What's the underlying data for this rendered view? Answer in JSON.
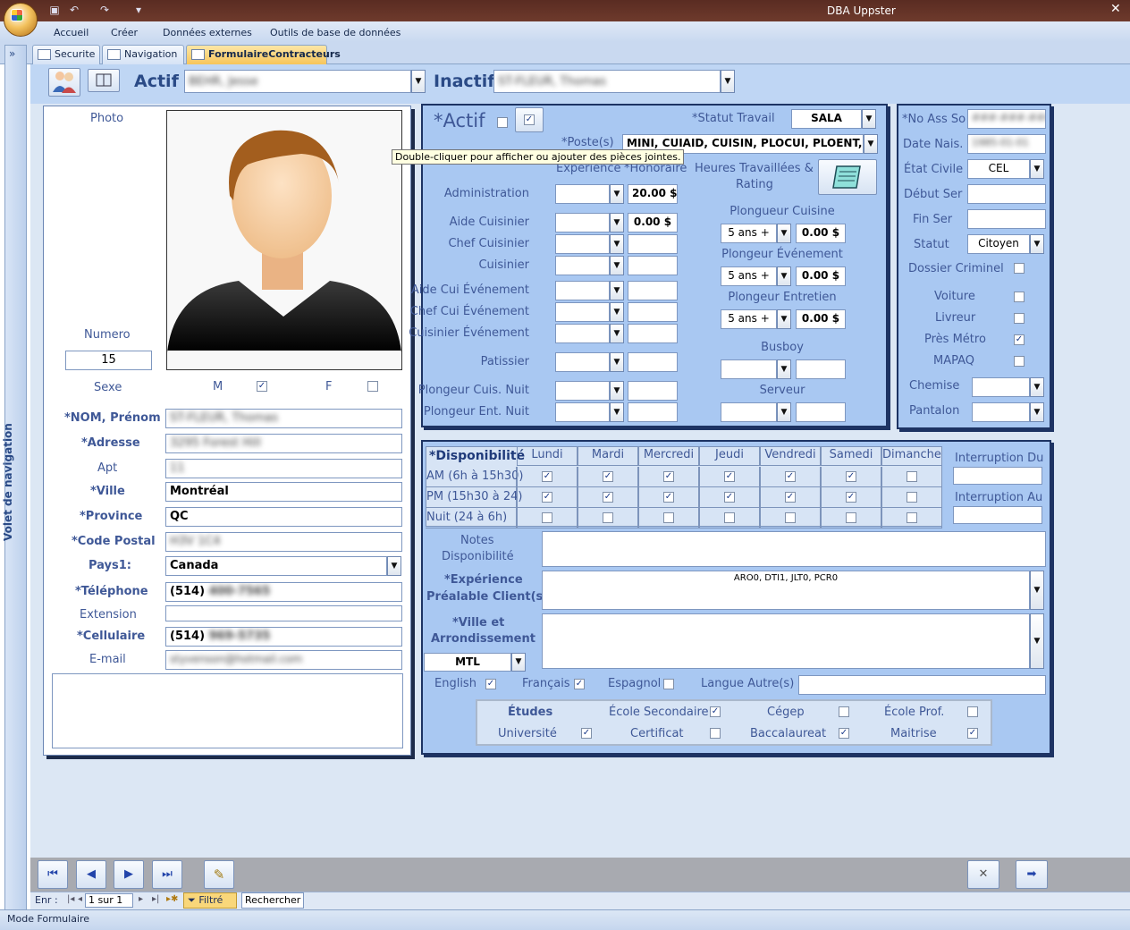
{
  "window": {
    "title": "DBA Uppster",
    "mode": "Mode Formulaire"
  },
  "ribbon": {
    "tabs": [
      "Accueil",
      "Créer",
      "Données externes",
      "Outils de base de données"
    ]
  },
  "nav_pane": {
    "label": "Volet de navigation",
    "toggle": "»"
  },
  "doc_tabs": [
    "Securite",
    "Navigation",
    "FormulaireContracteurs"
  ],
  "header": {
    "actif_label": "Actif",
    "actif_value": "BEHR, Jesse",
    "inactif_label": "Inactif",
    "inactif_value": "ST-FLEUR, Thomas"
  },
  "left": {
    "photo_label": "Photo",
    "numero_label": "Numero",
    "numero_value": "15",
    "sexe_label": "Sexe",
    "m_label": "M",
    "f_label": "F",
    "m_checked": true,
    "f_checked": false,
    "nom_label": "*NOM, Prénom",
    "nom_value": "ST-FLEUR, Thomas",
    "adresse_label": "*Adresse",
    "adresse_value": "3295 Forest Hill",
    "apt_label": "Apt",
    "apt_value": "11",
    "ville_label": "*Ville",
    "ville_value": "Montréal",
    "province_label": "*Province",
    "province_value": "QC",
    "cp_label": "*Code Postal",
    "cp_value": "H3V 1C4",
    "pays_label": "Pays1:",
    "pays_value": "Canada",
    "tel_label": "*Téléphone",
    "tel_prefix": "(514)",
    "tel_rest": "400-7565",
    "ext_label": "Extension",
    "cell_label": "*Cellulaire",
    "cell_prefix": "(514)",
    "cell_rest": "969-5735",
    "email_label": "E-mail",
    "email_value": "styvenson@hotmail.com"
  },
  "middle": {
    "actif_label": "*Actif",
    "statut_label": "*Statut Travail",
    "statut_value": "SALA",
    "poste_label": "*Poste(s)",
    "poste_value": "MINI, CUIAID, CUISIN, PLOCUI, PLOENT, PLOEVE",
    "tooltip": "Double-cliquer pour afficher ou ajouter des pièces jointes.",
    "exp_label": "Expérience",
    "hon_label": "*Honoraire",
    "heures_label1": "Heures Travaillées &",
    "heures_label2": "Rating",
    "roles": [
      {
        "label": "Administration",
        "exp": "",
        "hon": "20.00 $"
      },
      {
        "label": "Aide Cuisinier",
        "exp": "",
        "hon": "0.00 $"
      },
      {
        "label": "Chef Cuisinier",
        "exp": "",
        "hon": ""
      },
      {
        "label": "Cuisinier",
        "exp": "",
        "hon": ""
      },
      {
        "label": "Aide Cui Événement",
        "exp": "",
        "hon": ""
      },
      {
        "label": "Chef Cui Événement",
        "exp": "",
        "hon": ""
      },
      {
        "label": "Cuisinier Événement",
        "exp": "",
        "hon": ""
      },
      {
        "label": "Patissier",
        "exp": "",
        "hon": ""
      },
      {
        "label": "Plongeur Cuis. Nuit",
        "exp": "",
        "hon": ""
      },
      {
        "label": "Plongeur Ent. Nuit",
        "exp": "",
        "hon": ""
      }
    ],
    "right_roles": [
      {
        "label": "Plongueur Cuisine",
        "exp": "5 ans +",
        "hon": "0.00 $"
      },
      {
        "label": "Plongeur Événement",
        "exp": "5 ans +",
        "hon": "0.00 $"
      },
      {
        "label": "Plongeur Entretien",
        "exp": "5 ans +",
        "hon": "0.00 $"
      },
      {
        "label": "Busboy",
        "exp": "",
        "hon": ""
      },
      {
        "label": "Serveur",
        "exp": "",
        "hon": ""
      }
    ]
  },
  "right": {
    "noas_label": "*No Ass So",
    "noas_value": "###-###-###",
    "datenais_label": "Date Nais.",
    "datenais_value": "1985-01-01",
    "etat_label": "État Civile",
    "etat_value": "CEL",
    "debut_label": "Début Ser",
    "fin_label": "Fin Ser",
    "statut_label": "Statut",
    "statut_value": "Citoyen",
    "dossier_label": "Dossier Criminel",
    "dossier": false,
    "voiture_label": "Voiture",
    "voiture": false,
    "livreur_label": "Livreur",
    "livreur": false,
    "metro_label": "Près Métro",
    "metro": true,
    "mapaq_label": "MAPAQ",
    "mapaq": false,
    "chemise_label": "Chemise",
    "pantalon_label": "Pantalon"
  },
  "dispo": {
    "title": "*Disponibilité",
    "days": [
      "Lundi",
      "Mardi",
      "Mercredi",
      "Jeudi",
      "Vendredi",
      "Samedi",
      "Dimanche"
    ],
    "rows": [
      {
        "label": "AM (6h à 15h30)",
        "checks": [
          true,
          true,
          true,
          true,
          true,
          true,
          false
        ]
      },
      {
        "label": "PM (15h30 à 24)",
        "checks": [
          true,
          true,
          true,
          true,
          true,
          true,
          false
        ]
      },
      {
        "label": "Nuit (24 à 6h)",
        "checks": [
          false,
          false,
          false,
          false,
          false,
          false,
          false
        ]
      }
    ],
    "int_du_label": "Interruption Du",
    "int_au_label": "Interruption Au",
    "notes_label1": "Notes",
    "notes_label2": "Disponibilité",
    "exp_label1": "*Expérience",
    "exp_label2": "Préalable Client(s)",
    "exp_value": "ARO0, DTI1, JLT0, PCR0",
    "ville_label1": "*Ville et",
    "ville_label2": "Arrondissement",
    "ville_value": "MTL",
    "english_label": "English",
    "english": true,
    "francais_label": "Français",
    "francais": true,
    "espagnol_label": "Espagnol",
    "espagnol": false,
    "autre_label": "Langue Autre(s)",
    "etudes_label": "Études",
    "ecole_sec_label": "École Secondaire",
    "ecole_sec": true,
    "cegep_label": "Cégep",
    "cegep": false,
    "ecole_prof_label": "École Prof.",
    "ecole_prof": false,
    "univ_label": "Université",
    "univ": true,
    "certif_label": "Certificat",
    "certif": false,
    "bacc_label": "Baccalaureat",
    "bacc": true,
    "maitrise_label": "Maitrise",
    "maitrise": true
  },
  "recnav": {
    "enr_label": "Enr :",
    "pos": "1 sur 1",
    "filtre": "Filtré",
    "search": "Rechercher"
  }
}
